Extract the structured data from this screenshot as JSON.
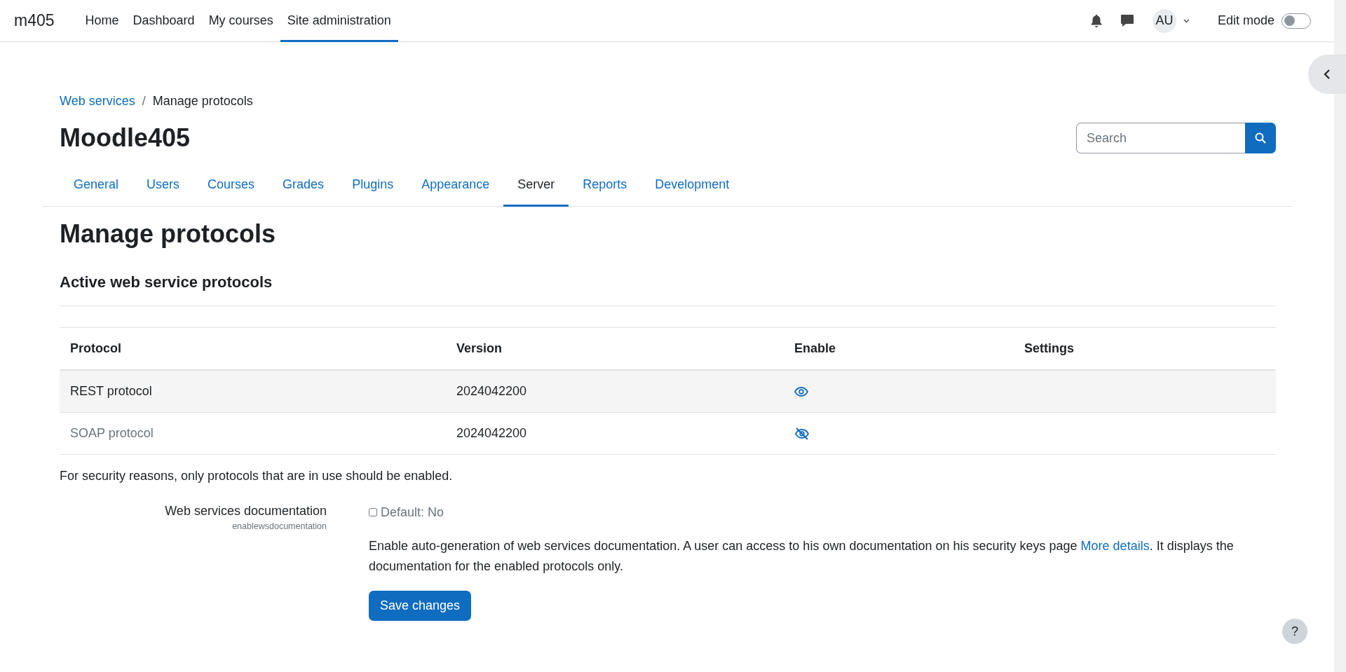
{
  "navbar": {
    "brand": "m405",
    "items": [
      {
        "label": "Home",
        "selected": false
      },
      {
        "label": "Dashboard",
        "selected": false
      },
      {
        "label": "My courses",
        "selected": false
      },
      {
        "label": "Site administration",
        "selected": true
      }
    ],
    "user_initials": "AU",
    "edit_mode": {
      "label": "Edit mode",
      "on": false
    }
  },
  "breadcrumb": [
    {
      "label": "Web services"
    },
    {
      "label": "Manage protocols"
    }
  ],
  "breadcrumb_separator": "/",
  "site_title": "Moodle405",
  "search": {
    "placeholder": "Search"
  },
  "tabs": [
    {
      "label": "General",
      "selected": false
    },
    {
      "label": "Users",
      "selected": false
    },
    {
      "label": "Courses",
      "selected": false
    },
    {
      "label": "Grades",
      "selected": false
    },
    {
      "label": "Plugins",
      "selected": false
    },
    {
      "label": "Appearance",
      "selected": false
    },
    {
      "label": "Server",
      "selected": true
    },
    {
      "label": "Reports",
      "selected": false
    },
    {
      "label": "Development",
      "selected": false
    }
  ],
  "page_heading": "Manage protocols",
  "section_heading": "Active web service protocols",
  "table": {
    "columns": [
      "Protocol",
      "Version",
      "Enable",
      "Settings"
    ],
    "rows": [
      {
        "protocol": "REST protocol",
        "version": "2024042200",
        "enabled": true
      },
      {
        "protocol": "SOAP protocol",
        "version": "2024042200",
        "enabled": false
      }
    ]
  },
  "note": "For security reasons, only protocols that are in use should be enabled.",
  "setting": {
    "label": "Web services documentation",
    "name": "enablewsdocumentation",
    "checkbox_label": "Default: No",
    "checked": false,
    "description_before": "Enable auto-generation of web services documentation. A user can access to his own documentation on his security keys page ",
    "link": "More details",
    "description_after": ". It displays the documentation for the enabled protocols only."
  },
  "save_button": "Save changes",
  "help_button": "?"
}
